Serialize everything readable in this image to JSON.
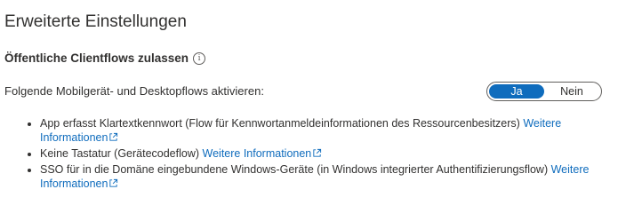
{
  "section": {
    "title": "Erweiterte Einstellungen"
  },
  "public_flows": {
    "heading": "Öffentliche Clientflows zulassen",
    "info_icon": "info-icon"
  },
  "toggle": {
    "label": "Folgende Mobilgerät- und Desktopflows aktivieren:",
    "options": [
      "Ja",
      "Nein"
    ],
    "selected": "Ja",
    "accent_color": "#0f6cbd"
  },
  "flows": [
    {
      "text": "App erfasst Klartextkennwort (Flow für Kennwortanmeldeinformationen des Ressourcenbesitzers) ",
      "link": "Weitere Informationen"
    },
    {
      "text": "Keine Tastatur (Gerätecodeflow) ",
      "link": "Weitere Informationen"
    },
    {
      "text": "SSO für in die Domäne eingebundene Windows-Geräte (in Windows integrierter Authentifizierungsflow) ",
      "link": "Weitere Informationen"
    }
  ],
  "link_color": "#0f6cbd",
  "link_icon": "external-link-icon"
}
